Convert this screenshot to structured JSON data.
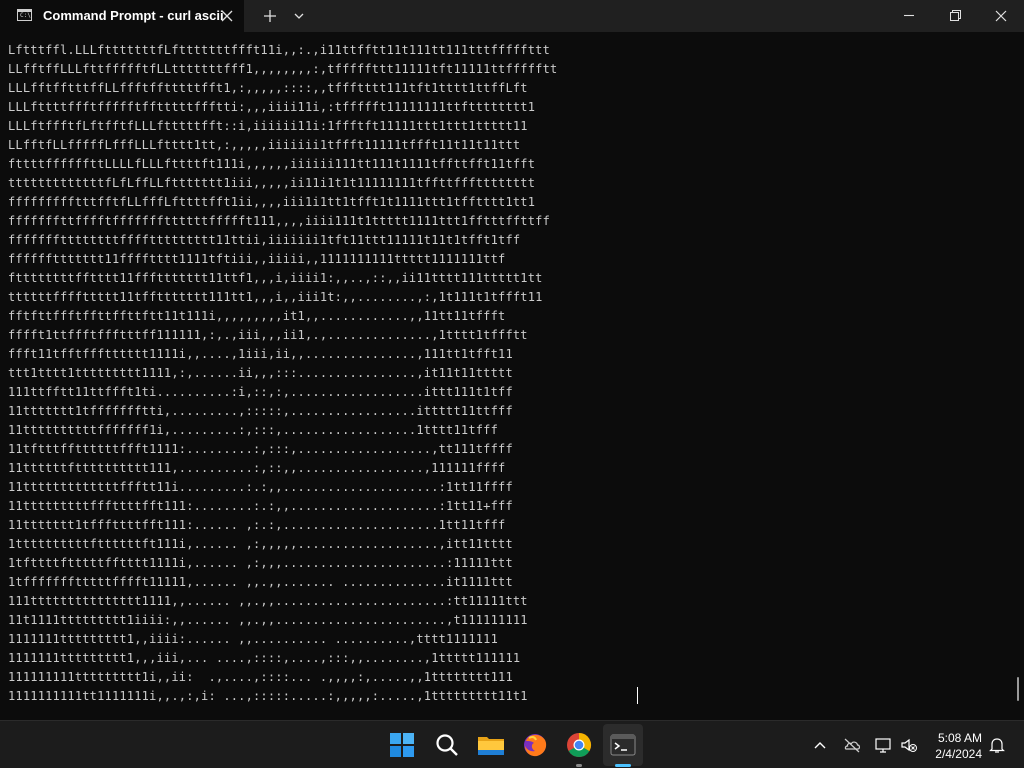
{
  "window": {
    "tab_title": "Command Prompt - curl  ascii",
    "tab_icon_text": "C:\\",
    "icons": {
      "tab_close": "close-icon",
      "new_tab": "plus-icon",
      "dropdown": "chevron-down-icon",
      "minimize": "minimize-icon",
      "maximize": "restore-icon",
      "close": "close-icon"
    }
  },
  "terminal": {
    "lines": [
      "Lftttffl.LLLftttttttfLftttttttffft11i,,:.,i11ttfftt11t111tt111tttfffffttt",
      "LLfftffLLLfttffffftfLLtttttttfff1,,,,,,,,:,tfffffttt11111tft11111ttffffftt",
      "LLLfftfftttffLLffftfftttttfft1,:,,,,,::::,,tffftttt111tft1tttt1ttffLft",
      "LLLfttttffftffffftfftttttffftti:,,,iiii11i,:tffffft11111111ttftttttttt1",
      "LLLftffftfLftfftfLLLftttttfft::i,iiiiii11i:1ffftft11111ttt1ttt1ttttt11",
      "LLfftfLLfffffLfffLLLftttt1tt,:,,,,,iiiiiii1tffft11111tffft11t11t11ttt",
      "fttttffffffttLLLLfLLLfttttft111i,,,,,,iiiiii111tt111t1111tffttfft11tfft",
      "tttttttttttttfLfLffLLfttttttt1iii,,,,,ii11i1t1t11111111tffttffftttttttt",
      "ffffffffftttfftfLLfffLfttttfft1ii,,,,iii1i1tt1tfft1t1111ttt1tfftttt1tt1",
      "fffffffttfffftfffffffttttttffffft111,,,,iiii111t1ttttt1111ttt1fftttffttff",
      "fffffffttttttttffffttttttttt11ttii,iiiiiii1tft11ttt11111t11t1tfft1tff",
      "ffffffttttttt11fffftttt1111tftiii,,iiiii,,1111111111ttttt1111111ttf",
      "fttttttttfftttt11fffttttttt11ttf1,,,i,iiii1:,,..,::,,ii11tttt111ttttt1tt",
      "ttttttffffttttt11tffttttttt111tt1,,,i,,iii1t:,,........,:,1t111t1tffft11",
      "fftfttffftffttffttftt11t111i,,,,,,,,,it1,,............,,11tt11tffft",
      "fffft1ttffftffftttff111111,:,.,iii,,,ii1,.,..............,1tttt1tffftt",
      "ffft11tfftffftttttt1111i,,....,1iii,ii,,...............,111tt1tfft11",
      "ttt1tttt1ttttttttt1111,:,......ii,,,:::................,it11t11ttttt",
      "111ttfftt11ttffft1ti..........:i,::,:,..................ittt111t1tff",
      "11ttttttt1tffffffftti,.........,:::::,.................ittttt11ttfff",
      "11ttttttttttfffffff1i,.........:,:::,..................1tttt11tfff",
      "11tftttffttttttffft1111:.........:,:::,..................,tt111tffff",
      "11ttttttftttttttttt111,..........:,::,,.................,111111ffff",
      "11tttttttttttttffftt11i.........:.:,,.....................:1tt11ffff",
      "11tttttttttfffttttfft111:........:.:,,....................:1tt11+fff",
      "11ttttttt1tfffttttfft111:...... ,:.:,.....................1tt11tfff",
      "1ttttttttttfttttttft111i,...... ,:,,,,,...................,itt11tttt",
      "1tfttttftttttfftttt1111i,...... ,:,,,......................:11111ttt",
      "1tffffffftttttfffft11111,...... ,,.,,....... ..............it1111ttt",
      "111ttttttttttttttt1111,,...... ,,.,,.......................:tt11111ttt",
      "11t1111ttttttttt1iiii:,,...... ,,.,,.......................,t111111111",
      "1111111ttttttttt1,,iiii:...... ,,.......... ..........,tttt1111111",
      "1111111ttttttttt1,,,iii,... ....,::::,....,:::,,........,1ttttt111111",
      "111111111ttttttttt1i,,ii:  .,....,::::... .,,,,:,.....,,1tttttttt111",
      "1111111111tt1111111i,,.,:,i: ...,:::::.....:,,,,,:.....,1ttttttttt11t1"
    ]
  },
  "taskbar": {
    "apps": [
      {
        "name": "start-icon"
      },
      {
        "name": "search-icon"
      },
      {
        "name": "file-explorer-icon"
      },
      {
        "name": "firefox-icon"
      },
      {
        "name": "chrome-icon"
      },
      {
        "name": "terminal-icon"
      }
    ],
    "tray_icons": [
      "chevron-up-icon",
      "onedrive-icon",
      "network-icon",
      "volume-muted-icon",
      "notification-icon"
    ],
    "time": "5:08 AM",
    "date": "2/4/2024"
  },
  "colors": {
    "terminal_bg": "#0c0c0c",
    "text": "#cccccc",
    "titlebar_bg": "#202020",
    "taskbar_bg": "#1c1c1c",
    "accent": "#4cc2ff"
  }
}
